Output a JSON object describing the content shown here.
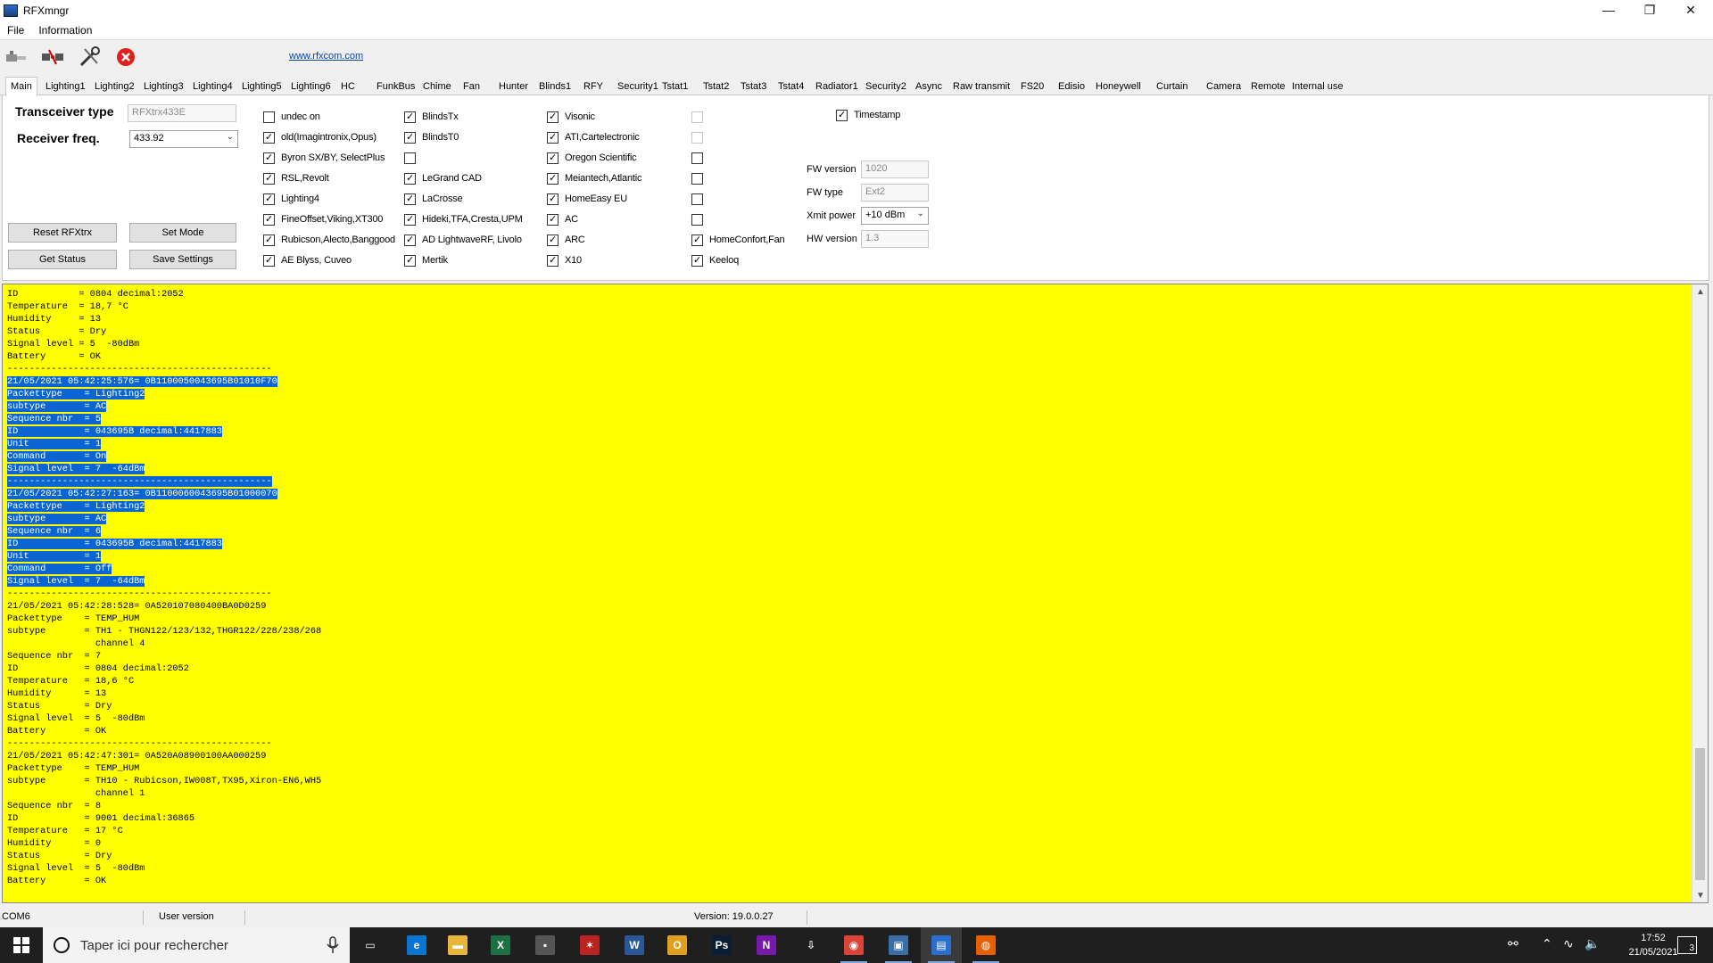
{
  "window": {
    "title": "RFXmngr",
    "minimize": "—",
    "maximize": "❐",
    "close": "✕"
  },
  "menu": [
    "File",
    "Information"
  ],
  "toolbar": {
    "link": "www.rfxcom.com"
  },
  "tabs": [
    "Main",
    "Lighting1",
    "Lighting2",
    "Lighting3",
    "Lighting4",
    "Lighting5",
    "Lighting6",
    "HC",
    "FunkBus",
    "Chime",
    "Fan",
    "Hunter",
    "Blinds1",
    "RFY",
    "Security1",
    "Tstat1",
    "Tstat2",
    "Tstat3",
    "Tstat4",
    "Radiator1",
    "Security2",
    "Async",
    "Raw transmit",
    "FS20",
    "Edisio",
    "Honeywell",
    "Curtain",
    "Camera",
    "Remote",
    "Internal use"
  ],
  "main": {
    "transceiver_label": "Transceiver type",
    "transceiver_value": "RFXtrx433E",
    "receiver_label": "Receiver freq.",
    "receiver_value": "433.92",
    "buttons": {
      "reset": "Reset RFXtrx",
      "set_mode": "Set Mode",
      "get_status": "Get Status",
      "save_settings": "Save Settings"
    },
    "checkboxes": {
      "col1": [
        {
          "label": "undec on",
          "checked": false
        },
        {
          "label": "old(Imagintronix,Opus)",
          "checked": true
        },
        {
          "label": "Byron SX/BY, SelectPlus",
          "checked": true
        },
        {
          "label": "RSL,Revolt",
          "checked": true
        },
        {
          "label": "Lighting4",
          "checked": true
        },
        {
          "label": "FineOffset,Viking,XT300",
          "checked": true
        },
        {
          "label": "Rubicson,Alecto,Banggood",
          "checked": true
        },
        {
          "label": "AE Blyss, Cuveo",
          "checked": true
        }
      ],
      "col2": [
        {
          "label": "BlindsTx",
          "checked": true
        },
        {
          "label": "BlindsT0",
          "checked": true
        },
        {
          "label": "",
          "checked": false
        },
        {
          "label": "LeGrand CAD",
          "checked": true
        },
        {
          "label": "LaCrosse",
          "checked": true
        },
        {
          "label": "Hideki,TFA,Cresta,UPM",
          "checked": true
        },
        {
          "label": "AD LightwaveRF, Livolo",
          "checked": true
        },
        {
          "label": "Mertik",
          "checked": true
        }
      ],
      "col3": [
        {
          "label": "Visonic",
          "checked": true
        },
        {
          "label": "ATI,Cartelectronic",
          "checked": true
        },
        {
          "label": "Oregon Scientific",
          "checked": true
        },
        {
          "label": "Meiantech,Atlantic",
          "checked": true
        },
        {
          "label": "HomeEasy EU",
          "checked": true
        },
        {
          "label": "AC",
          "checked": true
        },
        {
          "label": "ARC",
          "checked": true
        },
        {
          "label": "X10",
          "checked": true
        }
      ],
      "col4": [
        {
          "label": "",
          "checked": false,
          "disabled": true
        },
        {
          "label": "",
          "checked": false,
          "disabled": true
        },
        {
          "label": "",
          "checked": false
        },
        {
          "label": "",
          "checked": false
        },
        {
          "label": "",
          "checked": false
        },
        {
          "label": "",
          "checked": false
        },
        {
          "label": "HomeConfort,Fan",
          "checked": true
        },
        {
          "label": "Keeloq",
          "checked": true
        }
      ],
      "timestamp": {
        "label": "Timestamp",
        "checked": true
      }
    },
    "fw_version_label": "FW version",
    "fw_version_value": "1020",
    "fw_type_label": "FW type",
    "fw_type_value": "Ext2",
    "xmit_label": "Xmit power",
    "xmit_value": "+10 dBm",
    "hw_version_label": "HW version",
    "hw_version_value": "1.3"
  },
  "log": [
    {
      "t": "ID           = 0804 decimal:2052"
    },
    {
      "t": "Temperature  = 18,7 °C"
    },
    {
      "t": "Humidity     = 13"
    },
    {
      "t": "Status       = Dry"
    },
    {
      "t": "Signal level = 5  -80dBm"
    },
    {
      "t": "Battery      = OK"
    },
    {
      "t": "------------------------------------------------"
    },
    {
      "t": "21/05/2021 05:42:25:576= 0B1100050043695B01010F70",
      "sel": true
    },
    {
      "t": "Packettype    = Lighting2",
      "sel": true
    },
    {
      "t": "subtype       = AC",
      "sel": true
    },
    {
      "t": "Sequence nbr  = 5",
      "sel": true
    },
    {
      "t": "ID            = 043695B decimal:4417883",
      "sel": true
    },
    {
      "t": "Unit          = 1",
      "sel": true
    },
    {
      "t": "Command       = On",
      "sel": true
    },
    {
      "t": "Signal level  = 7  -64dBm",
      "sel": true
    },
    {
      "t": "------------------------------------------------",
      "sel": true
    },
    {
      "t": "21/05/2021 05:42:27:163= 0B1100060043695B01000070",
      "sel": true
    },
    {
      "t": "Packettype    = Lighting2",
      "sel": true
    },
    {
      "t": "subtype       = AC",
      "sel": true
    },
    {
      "t": "Sequence nbr  = 6",
      "sel": true
    },
    {
      "t": "ID            = 043695B decimal:4417883",
      "sel": true
    },
    {
      "t": "Unit          = 1",
      "sel": true
    },
    {
      "t": "Command       = Off",
      "sel": true
    },
    {
      "t": "Signal level  = 7  -64dBm",
      "sel": true
    },
    {
      "t": "------------------------------------------------"
    },
    {
      "t": "21/05/2021 05:42:28:528= 0A520107080400BA0D0259"
    },
    {
      "t": "Packettype    = TEMP_HUM"
    },
    {
      "t": "subtype       = TH1 - THGN122/123/132,THGR122/228/238/268"
    },
    {
      "t": "                channel 4"
    },
    {
      "t": "Sequence nbr  = 7"
    },
    {
      "t": "ID            = 0804 decimal:2052"
    },
    {
      "t": "Temperature   = 18,6 °C"
    },
    {
      "t": "Humidity      = 13"
    },
    {
      "t": "Status        = Dry"
    },
    {
      "t": "Signal level  = 5  -80dBm"
    },
    {
      "t": "Battery       = OK"
    },
    {
      "t": "------------------------------------------------"
    },
    {
      "t": "21/05/2021 05:42:47:301= 0A520A08900100AA000259"
    },
    {
      "t": "Packettype    = TEMP_HUM"
    },
    {
      "t": "subtype       = TH10 - Rubicson,IW008T,TX95,Xiron-EN6,WH5"
    },
    {
      "t": "                channel 1"
    },
    {
      "t": "Sequence nbr  = 8"
    },
    {
      "t": "ID            = 9001 decimal:36865"
    },
    {
      "t": "Temperature   = 17 °C"
    },
    {
      "t": "Humidity      = 0"
    },
    {
      "t": "Status        = Dry"
    },
    {
      "t": "Signal level  = 5  -80dBm"
    },
    {
      "t": "Battery       = OK"
    }
  ],
  "status": {
    "port": "COM6",
    "user": "User version",
    "version": "Version: 19.0.0.27"
  },
  "taskbar": {
    "search_placeholder": "Taper ici pour rechercher",
    "time": "17:52",
    "date": "21/05/2021",
    "notif_count": "3"
  }
}
